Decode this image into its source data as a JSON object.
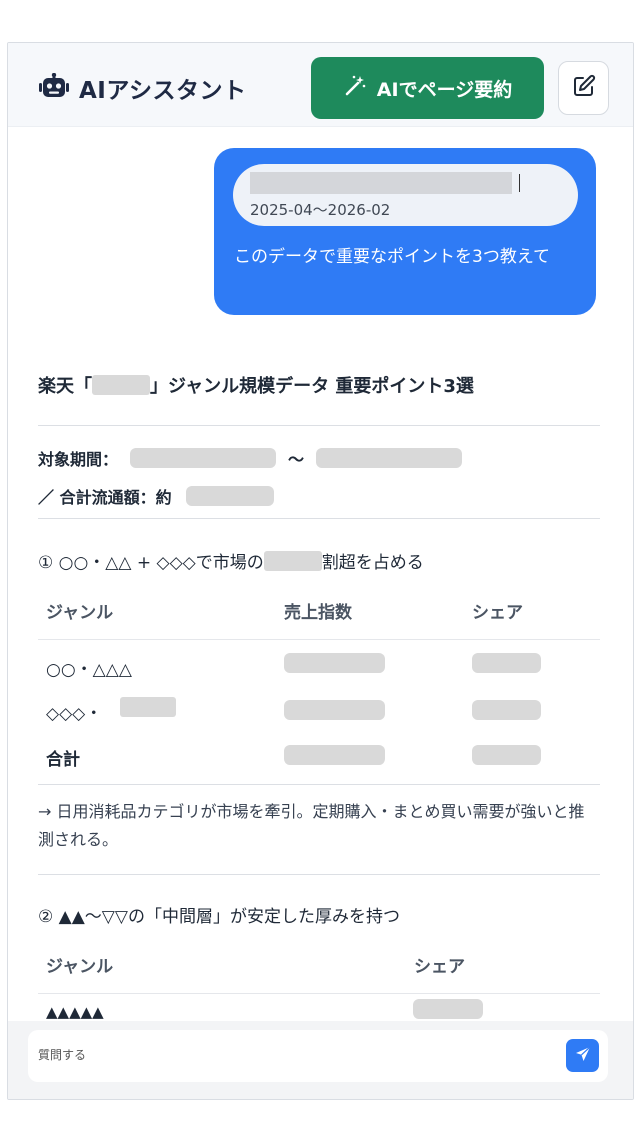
{
  "header": {
    "robot_icon": "robot-icon",
    "title": "AIアシスタント",
    "summarize_label": "AIでページ要約",
    "summarize_icon": "magic-wand-icon",
    "edit_icon": "edit-icon",
    "accent_color": "#1e8a5c"
  },
  "user_message": {
    "reference_range": "2025-04〜2026-02",
    "text": "このデータで重要なポイントを3つ教えて",
    "bubble_color": "#2f7bf5"
  },
  "answer": {
    "title_prefix": "楽天「",
    "title_suffix": "」ジャンル規模データ 重要ポイント3選",
    "period_label": "対象期間：",
    "period_separator": "〜",
    "total_label": "／ 合計流通額：約",
    "points": [
      {
        "title_prefix": "① ○○・△△ + ◇◇◇で市場の",
        "title_suffix": "割超を占める",
        "columns": [
          "ジャンル",
          "売上指数",
          "シェア"
        ],
        "rows": [
          {
            "genre": "○○・△△△"
          },
          {
            "genre": "◇◇◇・"
          },
          {
            "genre": "合計"
          }
        ],
        "note": "→ 日用消耗品カテゴリが市場を牽引。定期購入・まとめ買い需要が強いと推測される。"
      },
      {
        "title": "② ▲▲〜▽▽の「中間層」が安定した厚みを持つ",
        "columns": [
          "ジャンル",
          "シェア"
        ],
        "rows": [
          {
            "genre": "▲▲▲▲▲"
          }
        ]
      }
    ]
  },
  "composer": {
    "placeholder": "質問する",
    "send_icon": "send-icon"
  }
}
